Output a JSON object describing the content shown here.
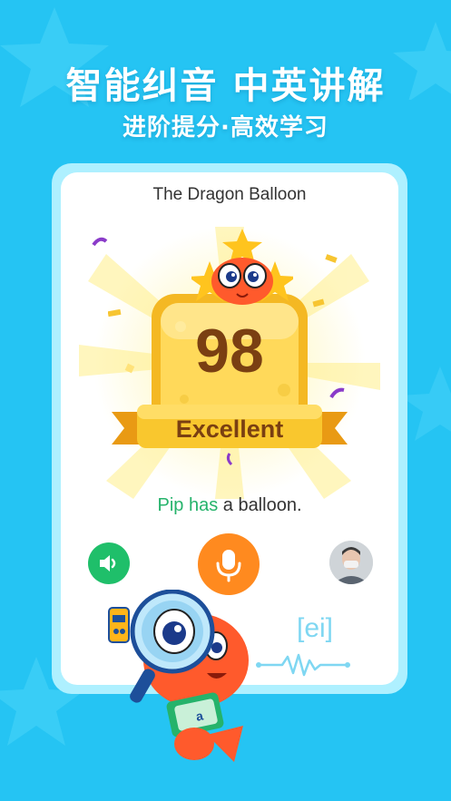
{
  "promo": {
    "headline": "智能纠音 中英讲解",
    "subheadline": "进阶提分·高效学习"
  },
  "lesson": {
    "title": "The Dragon Balloon",
    "score": "98",
    "rating": "Excellent",
    "sentence_highlight": "Pip has",
    "sentence_rest": " a balloon."
  },
  "controls": {
    "speaker": "speaker-icon",
    "record": "microphone-icon",
    "playback": "user-recording-avatar"
  },
  "phonics": {
    "phoneme": "[ei]"
  },
  "colors": {
    "background": "#25c4f3",
    "highlight_text": "#25b36b",
    "speaker_button": "#1fbf6a",
    "mic_button": "#ff8a1f",
    "badge_gold": "#f7c531",
    "score_text": "#7a3f12"
  }
}
